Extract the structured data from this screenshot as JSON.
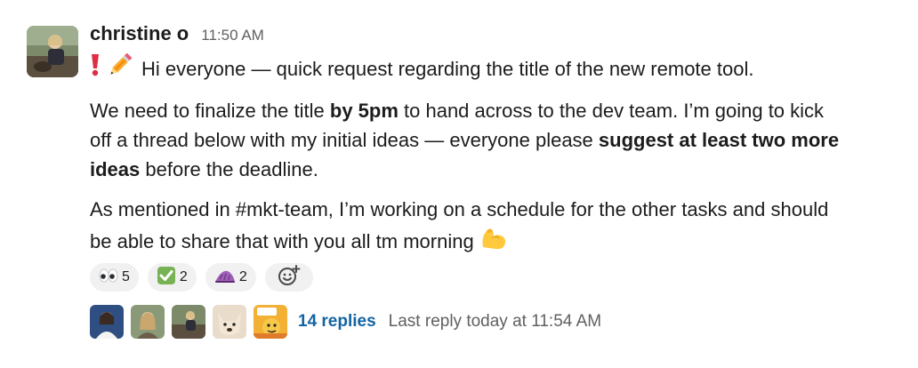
{
  "message": {
    "author": "christine o",
    "time": "11:50 AM",
    "line1": "Hi everyone — quick request regarding the title of the new remote tool.",
    "para2": {
      "l1_a": "We need to finalize the title ",
      "l1_b": "by 5pm",
      "l1_c": " to hand across to the dev team. I’m going to kick",
      "l2_a": "off a thread below with my initial ideas — everyone please ",
      "l2_b": "suggest at least two more",
      "l3_a": "ideas",
      "l3_b": " before the deadline."
    },
    "para3": {
      "l1": "As mentioned in #mkt-team, I’m working on a schedule for the other tasks and should",
      "l2": "be able to share that with you all tm morning "
    },
    "line1_icons": [
      "exclamation-icon",
      "pencil-icon"
    ],
    "para3_icon": "flexed-biceps-icon"
  },
  "reactions": [
    {
      "icon": "eyes-icon",
      "count": "5"
    },
    {
      "icon": "white-check-mark-icon",
      "count": "2"
    },
    {
      "icon": "party-hat-icon",
      "count": "2"
    }
  ],
  "add_reaction_icon": "add-reaction-icon",
  "thread": {
    "replies": "14 replies",
    "last_reply": "Last reply today at 11:54 AM"
  },
  "colors": {
    "link": "#1264a3",
    "muted": "#616061",
    "text": "#1d1c1d",
    "reaction_bg": "#f1f1f1"
  }
}
